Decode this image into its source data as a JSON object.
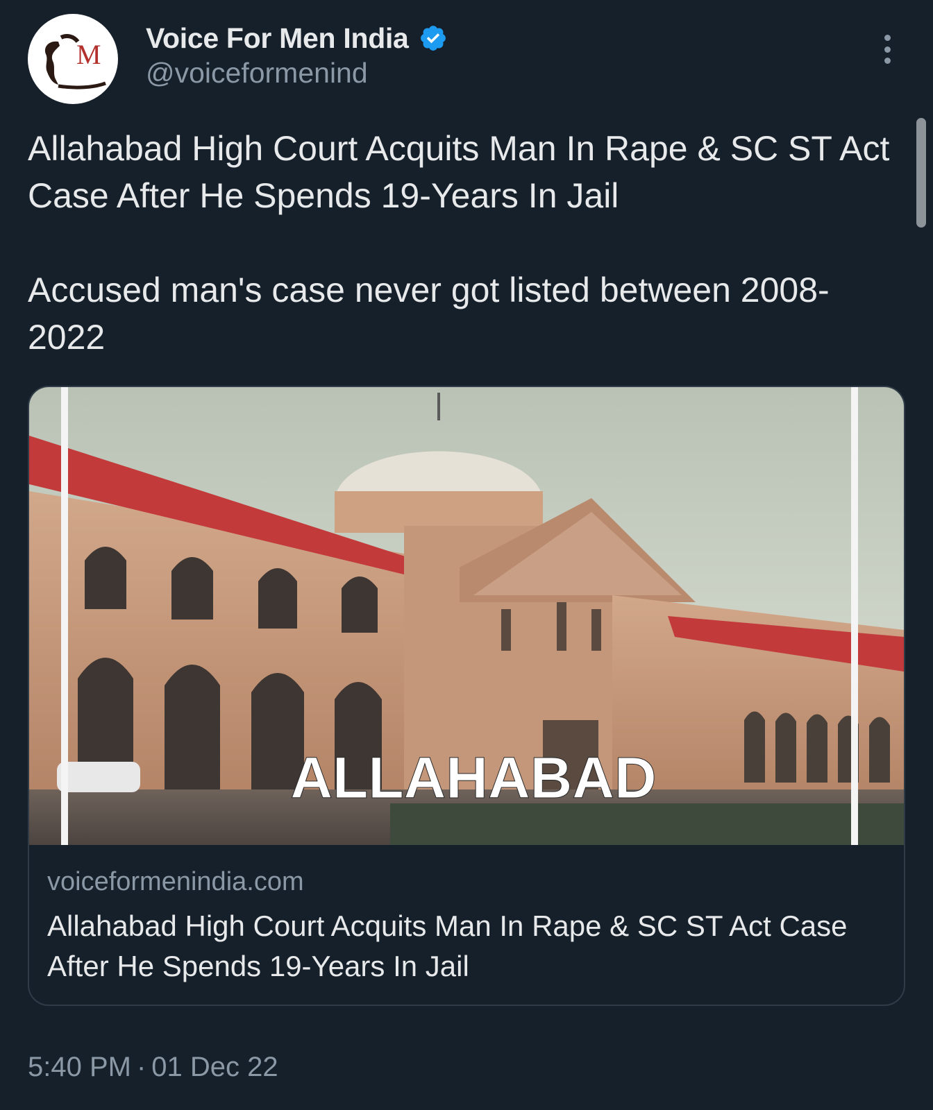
{
  "author": {
    "display_name": "Voice For Men India",
    "handle": "@voiceformenind",
    "verified": true,
    "avatar_letter": "M"
  },
  "tweet": {
    "paragraph_1": "Allahabad High Court Acquits Man In Rape & SC ST Act Case After He Spends 19-Years In Jail",
    "paragraph_2": "Accused man's case never got listed between 2008-2022"
  },
  "link_card": {
    "image_caption": "ALLAHABAD",
    "domain": "voiceformenindia.com",
    "title": "Allahabad High Court Acquits Man In Rape & SC ST Act Case After He Spends 19-Years In Jail"
  },
  "meta": {
    "time": "5:40 PM",
    "separator": "·",
    "date": "01 Dec 22"
  },
  "colors": {
    "background": "#16202b",
    "verified_badge": "#1d9bf0",
    "secondary_text": "#8b98a5",
    "roof_red": "#c23a3a"
  }
}
